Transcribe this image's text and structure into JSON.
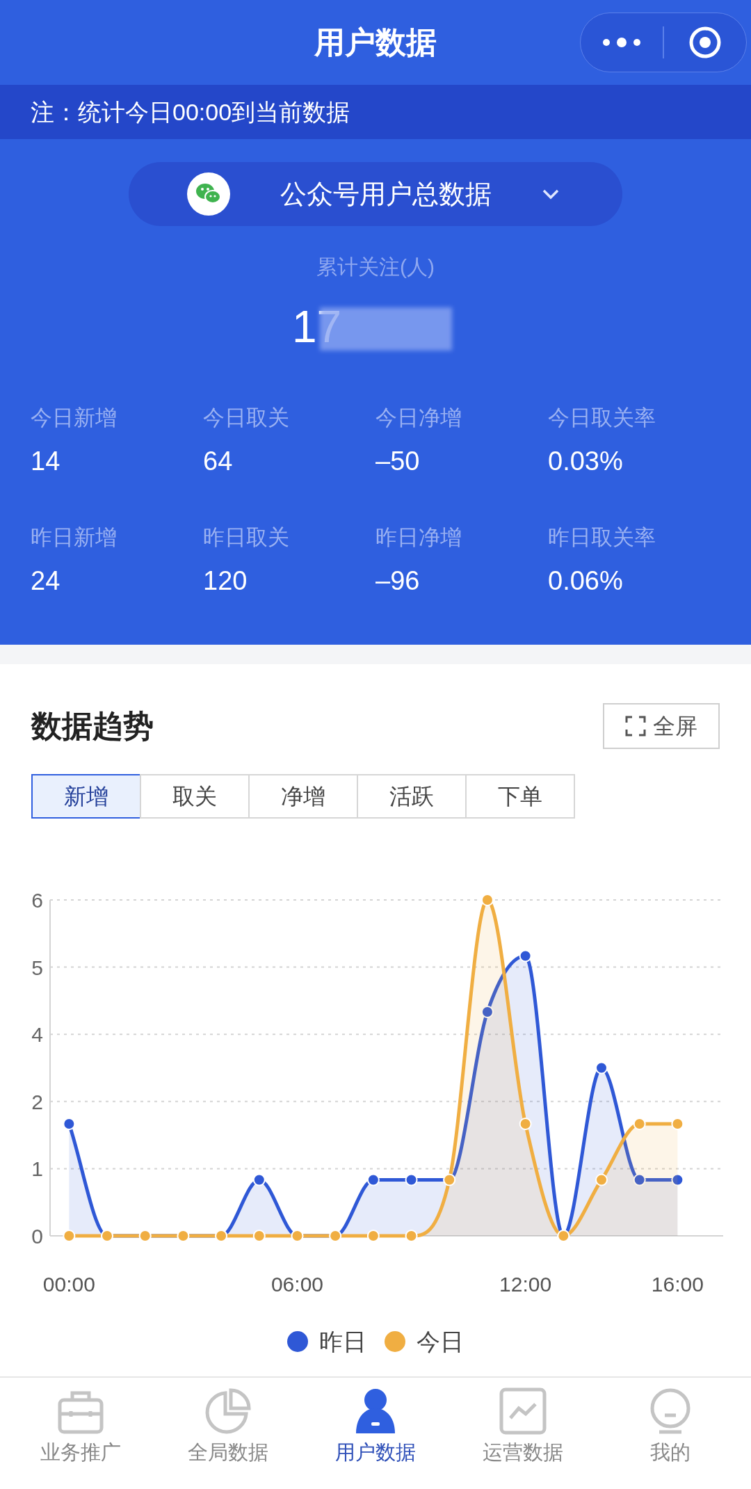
{
  "header": {
    "title": "用户数据"
  },
  "notice": "注：统计今日00:00到当前数据",
  "account_selector": {
    "label": "公众号用户总数据"
  },
  "total": {
    "label": "累计关注(人)",
    "value": "17"
  },
  "stats": [
    {
      "label": "今日新增",
      "value": "14"
    },
    {
      "label": "今日取关",
      "value": "64"
    },
    {
      "label": "今日净增",
      "value": "–50"
    },
    {
      "label": "今日取关率",
      "value": "0.03%"
    },
    {
      "label": "昨日新增",
      "value": "24"
    },
    {
      "label": "昨日取关",
      "value": "120"
    },
    {
      "label": "昨日净增",
      "value": "–96"
    },
    {
      "label": "昨日取关率",
      "value": "0.06%"
    }
  ],
  "trend": {
    "title": "数据趋势",
    "fullscreen": "全屏",
    "tabs": [
      {
        "label": "新增",
        "selected": true
      },
      {
        "label": "取关",
        "selected": false
      },
      {
        "label": "净增",
        "selected": false
      },
      {
        "label": "活跃",
        "selected": false
      },
      {
        "label": "下单",
        "selected": false
      }
    ],
    "chart_data": {
      "type": "area",
      "grid": true,
      "xlim": [
        -0.5,
        17.2
      ],
      "x": [
        0,
        1,
        2,
        3,
        4,
        5,
        6,
        7,
        8,
        9,
        10,
        11,
        12,
        13,
        14,
        15,
        16
      ],
      "xticks": [
        {
          "value": 0,
          "label": "00:00"
        },
        {
          "value": 6,
          "label": "06:00"
        },
        {
          "value": 12,
          "label": "12:00"
        },
        {
          "value": 16,
          "label": "16:00"
        }
      ],
      "ylim": [
        0,
        6
      ],
      "yticks": [
        {
          "value": 0,
          "label": "0"
        },
        {
          "value": 1.2,
          "label": "1"
        },
        {
          "value": 2.4,
          "label": "2"
        },
        {
          "value": 3.6,
          "label": "4"
        },
        {
          "value": 4.8,
          "label": "5"
        },
        {
          "value": 6,
          "label": "6"
        }
      ],
      "series": [
        {
          "name": "昨日",
          "color": "#2f58d6",
          "marker": "circle",
          "values": [
            2,
            0,
            0,
            0,
            0,
            1,
            0,
            0,
            1,
            1,
            1,
            4,
            5,
            0,
            3,
            1,
            1
          ]
        },
        {
          "name": "今日",
          "color": "#f0ae42",
          "marker": "circle",
          "values": [
            0,
            0,
            0,
            0,
            0,
            0,
            0,
            0,
            0,
            0,
            1,
            6,
            2,
            0,
            1,
            2,
            2
          ]
        }
      ]
    }
  },
  "nav": [
    {
      "label": "业务推广",
      "selected": false
    },
    {
      "label": "全局数据",
      "selected": false
    },
    {
      "label": "用户数据",
      "selected": true
    },
    {
      "label": "运营数据",
      "selected": false
    },
    {
      "label": "我的",
      "selected": false
    }
  ]
}
